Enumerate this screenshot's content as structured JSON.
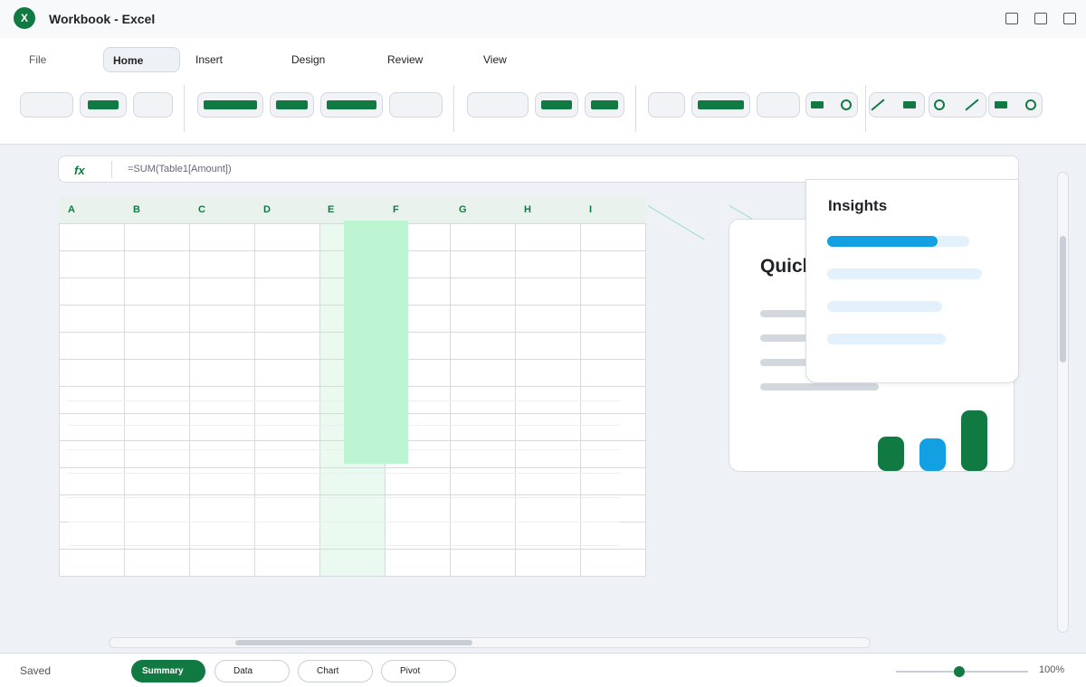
{
  "window": {
    "title": "Workbook - Excel",
    "logo_letter": "X"
  },
  "tabs": [
    {
      "label": "File"
    },
    {
      "label": "Home",
      "active": true
    },
    {
      "label": "Insert"
    },
    {
      "label": "Design"
    },
    {
      "label": "Review"
    },
    {
      "label": "View"
    }
  ],
  "formula_bar": {
    "fx_label": "fx",
    "formula": "=SUM(Table1[Amount])"
  },
  "grid": {
    "columns": [
      "A",
      "B",
      "C",
      "D",
      "E",
      "F",
      "G",
      "H",
      "I"
    ]
  },
  "quick_card": {
    "title": "Quick"
  },
  "insights": {
    "title": "Insights"
  },
  "status_bar": {
    "status": "Saved",
    "sheets": [
      {
        "label": "Summary",
        "active": true
      },
      {
        "label": "Data"
      },
      {
        "label": "Chart"
      },
      {
        "label": "Pivot"
      }
    ],
    "zoom": "100%",
    "zoom_level": 0.5
  },
  "colors": {
    "accent_green": "#117a43",
    "accent_blue": "#12a0e3",
    "highlight_green": "#bdf5d2"
  }
}
